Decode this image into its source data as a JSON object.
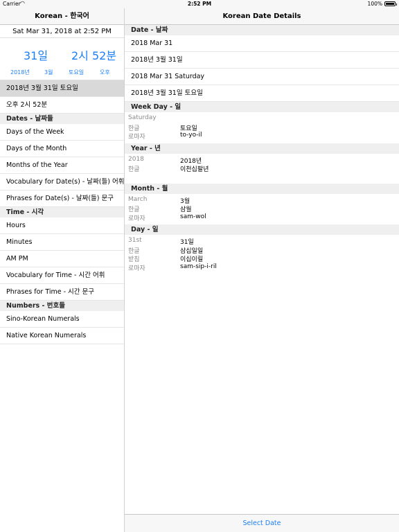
{
  "status": {
    "carrier": "Carrier",
    "time": "2:52 PM",
    "battery": "100%",
    "battery_level": 1.0
  },
  "master": {
    "title": "Korean - 한국어",
    "date_line": "Sat Mar 31, 2018 at 2:52 PM",
    "big_day": "31일",
    "big_time": "2시 52분",
    "small": [
      "2018년",
      "3월",
      "토요일",
      "오후"
    ],
    "selected_item": "2018년 3월 31일 토요일",
    "time_item": "오후  2시 52분",
    "sections": [
      {
        "title": "Dates - 날짜들",
        "items": [
          "Days of the Week",
          "Days of the Month",
          "Months of the Year",
          "Vocabulary for Date(s) - 날짜(들) 어휘",
          "Phrases for Date(s) - 날짜(들) 문구"
        ]
      },
      {
        "title": "Time - 시각",
        "items": [
          "Hours",
          "Minutes",
          "AM PM",
          "Vocabulary for Time - 시간 어휘",
          "Phrases for Time - 시간 문구"
        ]
      },
      {
        "title": "Numbers - 번호들",
        "items": [
          "Sino-Korean Numerals",
          "Native Korean Numerals"
        ]
      }
    ]
  },
  "detail": {
    "title": "Korean Date Details",
    "date_section": "Date - 날짜",
    "date_items": [
      "2018 Mar 31",
      "2018년 3월 31일",
      "2018 Mar 31 Saturday",
      "2018년 3월 31일 토요일"
    ],
    "weekday": {
      "title": "Week Day - 일",
      "rows": [
        {
          "k": "Saturday",
          "v": ""
        },
        {
          "k": "한글",
          "v": "토요일"
        },
        {
          "k": "로마자",
          "v": "to-yo-il"
        }
      ]
    },
    "year": {
      "title": "Year - 년",
      "rows": [
        {
          "k": "2018",
          "v": "2018년"
        },
        {
          "k": "한글",
          "v": "이천십팔년"
        }
      ]
    },
    "month": {
      "title": "Month - 월",
      "rows": [
        {
          "k": "March",
          "v": "3월"
        },
        {
          "k": "한글",
          "v": "삼월"
        },
        {
          "k": "로마자",
          "v": "sam-wol"
        }
      ]
    },
    "day": {
      "title": "Day - 일",
      "rows": [
        {
          "k": "31st",
          "v": "31일"
        },
        {
          "k": "한글",
          "v": "삼십일일"
        },
        {
          "k": "받침",
          "v": "이십이릴"
        },
        {
          "k": "로마자",
          "v": "sam-sip-i-ril"
        }
      ]
    },
    "select_button": "Select Date"
  }
}
